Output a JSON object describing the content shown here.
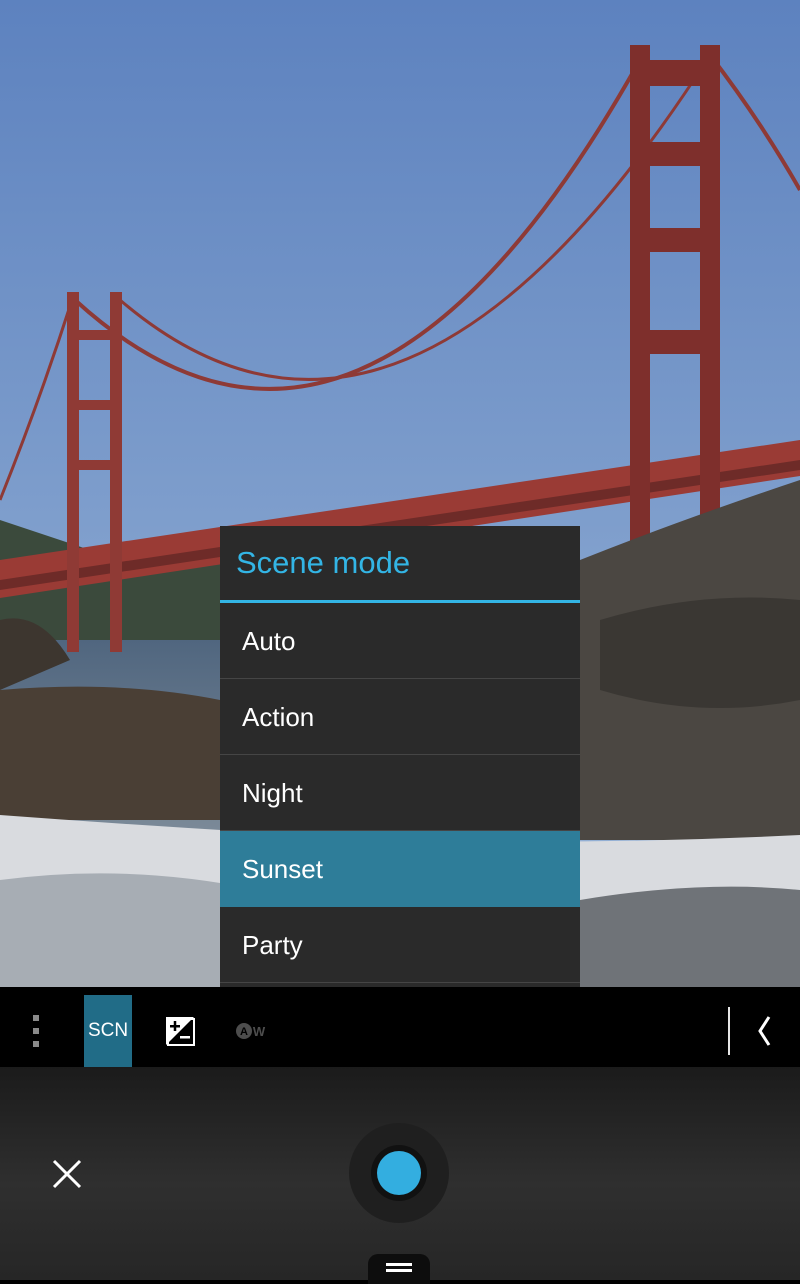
{
  "viewfinder": {
    "description_icon": "bridge-photo"
  },
  "scene_mode": {
    "title": "Scene mode",
    "items": [
      {
        "label": "Auto",
        "selected": false
      },
      {
        "label": "Action",
        "selected": false
      },
      {
        "label": "Night",
        "selected": false
      },
      {
        "label": "Sunset",
        "selected": true
      },
      {
        "label": "Party",
        "selected": false
      }
    ]
  },
  "toolbar": {
    "menu_icon": "more-vert-icon",
    "scene_label": "SCN",
    "exposure_icon": "exposure-icon",
    "white_balance_icon": "auto-white-balance-icon",
    "collapse_icon": "chevron-left-icon"
  },
  "controls": {
    "close_icon": "close-icon",
    "shutter_icon": "shutter-icon",
    "handle_icon": "drag-handle-icon"
  },
  "colors": {
    "accent": "#33b5e5",
    "selected_item": "#2e7d99",
    "scn_background": "#216c87",
    "shutter": "#33aee0"
  }
}
